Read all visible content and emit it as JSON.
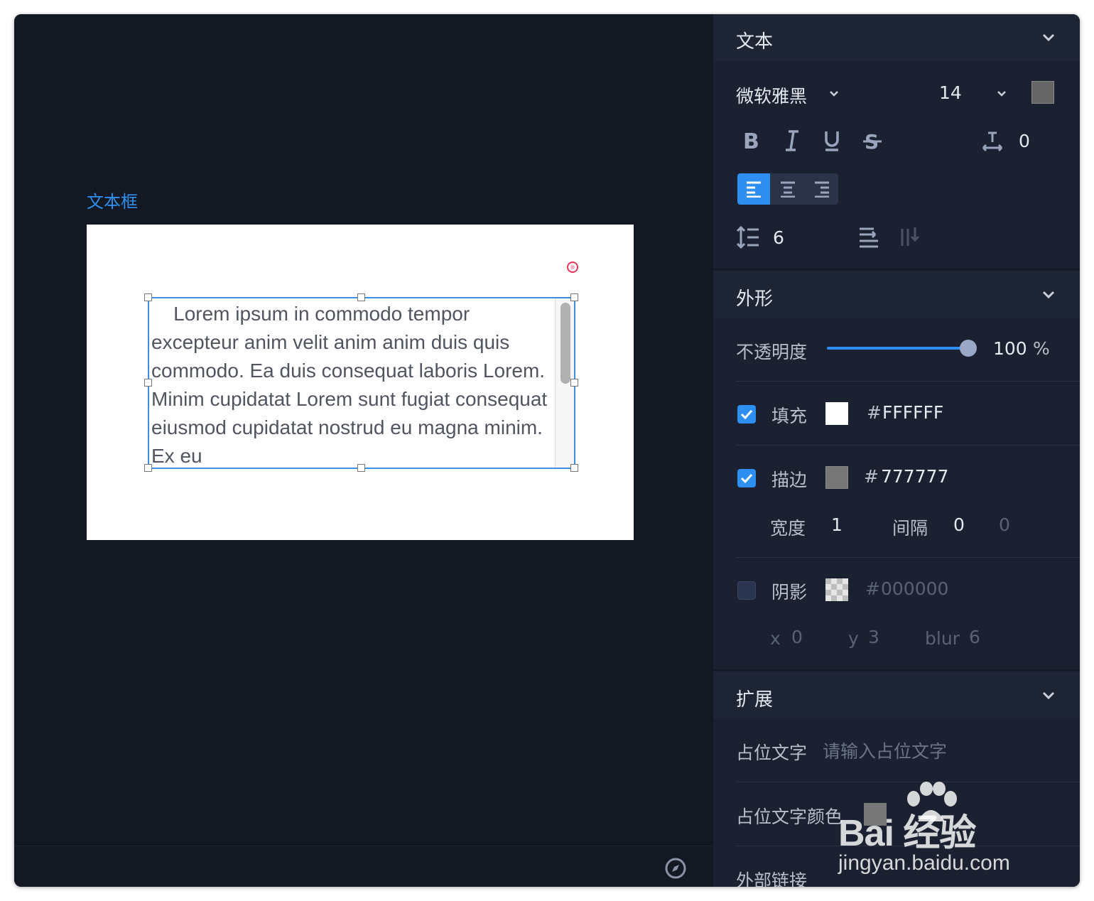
{
  "canvas": {
    "widget_label": "文本框",
    "textbox_text": "    Lorem ipsum in commodo tempor excepteur anim velit anim anim duis quis commodo. Ea duis consequat laboris Lorem. Minim cupidatat Lorem sunt fugiat consequat eiusmod cupidatat nostrud eu magna minim. Ex eu"
  },
  "text_section": {
    "title": "文本",
    "font_family": "微软雅黑",
    "font_size": "14",
    "text_color": "#666666",
    "letter_spacing": "0",
    "line_height": "6",
    "align_active": "left"
  },
  "shape_section": {
    "title": "外形",
    "opacity_label": "不透明度",
    "opacity_value": "100",
    "opacity_unit": "%",
    "fill_label": "填充",
    "fill_checked": true,
    "fill_color": "#FFFFFF",
    "fill_hash": "#",
    "fill_hex": "FFFFFF",
    "stroke_label": "描边",
    "stroke_checked": true,
    "stroke_color": "#777777",
    "stroke_hash": "#",
    "stroke_hex": "777777",
    "width_label": "宽度",
    "width_value": "1",
    "gap_label": "间隔",
    "gap_value": "0",
    "gap_value2": "0",
    "shadow_label": "阴影",
    "shadow_checked": false,
    "shadow_hash": "#",
    "shadow_hex": "000000",
    "shadow_x_label": "x",
    "shadow_x": "0",
    "shadow_y_label": "y",
    "shadow_y": "3",
    "shadow_blur_label": "blur",
    "shadow_blur": "6"
  },
  "extend_section": {
    "title": "扩展",
    "placeholder_label": "占位文字",
    "placeholder_input_placeholder": "请输入占位文字",
    "placeholder_color_label": "占位文字颜色",
    "external_link_label": "外部链接"
  },
  "watermark": {
    "brand": "Bai  经验",
    "url": "jingyan.baidu.com"
  },
  "colors": {
    "accent": "#2f8ff0",
    "panel_bg": "#1b2130",
    "canvas_bg": "#141822",
    "rotate_handle": "#e8335a"
  }
}
